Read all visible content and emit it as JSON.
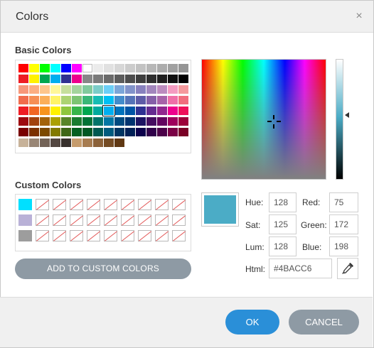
{
  "dialog": {
    "title": "Colors",
    "close_glyph": "×",
    "close_icon": "close-icon"
  },
  "basic": {
    "label": "Basic Colors",
    "rows": [
      [
        "#ff0000",
        "#ffff00",
        "#00ff00",
        "#00ffff",
        "#0000ff",
        "#ff00ff",
        "#ffffff",
        "#ebebeb",
        "#e1e1e1",
        "#d7d7d7",
        "#cccccc",
        "#c2c2c2",
        "#b7b7b7",
        "#acacac",
        "#a0a0a0",
        "#959595"
      ],
      [
        "#ee1d24",
        "#fff100",
        "#00a650",
        "#00aeef",
        "#2f3192",
        "#ed008c",
        "#878787",
        "#7a7a7a",
        "#6b6b6b",
        "#5c5c5c",
        "#4d4d4d",
        "#3e3e3e",
        "#2f2f2f",
        "#202020",
        "#111111",
        "#000000"
      ],
      [
        "#f7977a",
        "#fbad82",
        "#fdc68c",
        "#fff799",
        "#c6df9c",
        "#a4d49d",
        "#81ca9d",
        "#7bcdc9",
        "#6ccff7",
        "#7ca6d8",
        "#8293ca",
        "#8881be",
        "#a286bd",
        "#bc8cbf",
        "#f49bc1",
        "#f5999d"
      ],
      [
        "#f16c4d",
        "#f68e55",
        "#fbaf5a",
        "#fff467",
        "#acd372",
        "#7dc473",
        "#39b778",
        "#16bcb4",
        "#00bff3",
        "#438ccb",
        "#5573b7",
        "#5e5ca7",
        "#855fa8",
        "#a763a9",
        "#ef6ea8",
        "#f16d7e"
      ],
      [
        "#ee1d24",
        "#f16522",
        "#f7941d",
        "#fff100",
        "#8fc63d",
        "#37b44a",
        "#00a650",
        "#00a99e",
        "#00aeef",
        "#0072bc",
        "#0054a5",
        "#2f3192",
        "#652c91",
        "#91278f",
        "#ed008c",
        "#ee105a"
      ],
      [
        "#9d0a0f",
        "#a1410d",
        "#a36209",
        "#aba000",
        "#588528",
        "#197b30",
        "#007236",
        "#00736a",
        "#0076a4",
        "#004a80",
        "#003370",
        "#1d1363",
        "#450e61",
        "#62055f",
        "#9e005c",
        "#9d0039"
      ],
      [
        "#790000",
        "#7b3000",
        "#7c4900",
        "#827a00",
        "#3e6617",
        "#045f20",
        "#005824",
        "#005951",
        "#005b7e",
        "#003562",
        "#002056",
        "#0c004b",
        "#30004a",
        "#4b0048",
        "#7a0045",
        "#7a0026"
      ],
      [
        "#c7b299",
        "#998675",
        "#736357",
        "#534741",
        "#37302d",
        "#c69c6d",
        "#a77c50",
        "#8c6239",
        "#754c24",
        "#603813"
      ]
    ],
    "selected": "4,8"
  },
  "custom": {
    "label": "Custom Colors",
    "rows": [
      [
        "#00e0ff",
        "",
        "",
        "",
        "",
        "",
        "",
        "",
        "",
        ""
      ],
      [
        "#b9b1d7",
        "",
        "",
        "",
        "",
        "",
        "",
        "",
        "",
        ""
      ],
      [
        "#9d9d9d",
        "",
        "",
        "",
        "",
        "",
        "",
        "",
        "",
        ""
      ]
    ],
    "add_button": "ADD TO CUSTOM COLORS"
  },
  "picker": {
    "spectrum_icon": "crosshair-icon",
    "luminance_arrow_icon": "triangle-left-icon",
    "current_color": "#4BACC6"
  },
  "fields": {
    "hue_label": "Hue:",
    "hue": "128",
    "sat_label": "Sat:",
    "sat": "125",
    "lum_label": "Lum:",
    "lum": "128",
    "red_label": "Red:",
    "red": "75",
    "green_label": "Green:",
    "green": "172",
    "blue_label": "Blue:",
    "blue": "198",
    "html_label": "Html:",
    "html": "#4BACC6",
    "eyedropper_icon": "eyedropper-icon"
  },
  "footer": {
    "ok": "OK",
    "cancel": "CANCEL"
  }
}
